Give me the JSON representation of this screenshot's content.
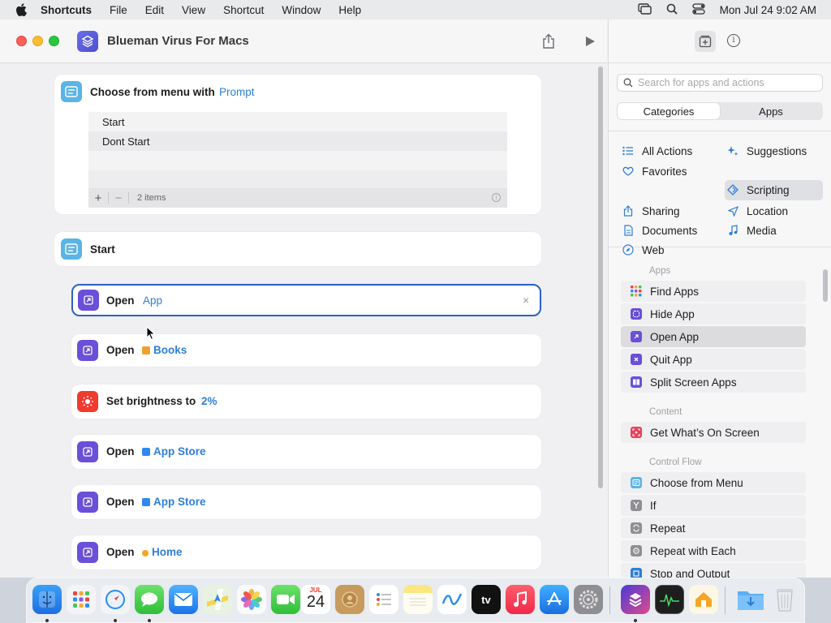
{
  "menubar": {
    "app_name": "Shortcuts",
    "menus": [
      "File",
      "Edit",
      "View",
      "Shortcut",
      "Window",
      "Help"
    ],
    "clock": "Mon Jul 24  9:02 AM"
  },
  "window": {
    "title": "Blueman Virus For Macs"
  },
  "editor": {
    "choose_menu": {
      "label": "Choose from menu with",
      "token": "Prompt",
      "items": [
        "Start",
        "Dont Start"
      ],
      "footer_count": "2 items"
    },
    "start_block": {
      "label": "Start"
    },
    "actions": [
      {
        "label": "Open",
        "token": "App",
        "token_bold": false,
        "icon": "open-app-icon",
        "color": "#6a4fd8"
      },
      {
        "label": "Open",
        "token": "Books",
        "token_bold": true,
        "icon": "open-app-icon",
        "color": "#6a4fd8",
        "mini_color": "#f0a030"
      },
      {
        "label": "Set brightness to",
        "token": "2%",
        "token_bold": true,
        "icon": "brightness-icon",
        "color": "#f03a2e"
      },
      {
        "label": "Open",
        "token": "App Store",
        "token_bold": true,
        "icon": "open-app-icon",
        "color": "#6a4fd8",
        "mini_color": "#2e8af0"
      },
      {
        "label": "Open",
        "token": "App Store",
        "token_bold": true,
        "icon": "open-app-icon",
        "color": "#6a4fd8",
        "mini_color": "#2e8af0"
      },
      {
        "label": "Open",
        "token": "Home",
        "token_bold": true,
        "icon": "open-app-icon",
        "color": "#6a4fd8",
        "mini_color": "#f5a623"
      }
    ]
  },
  "panel": {
    "search_placeholder": "Search for apps and actions",
    "segments": [
      "Categories",
      "Apps"
    ],
    "categories": [
      {
        "label": "All Actions",
        "icon": "list-icon"
      },
      {
        "label": "Suggestions",
        "icon": "sparkle-icon"
      },
      {
        "label": "Favorites",
        "icon": "heart-icon"
      },
      {
        "label": "Scripting",
        "icon": "scripting-icon"
      },
      {
        "label": "Sharing",
        "icon": "share-icon"
      },
      {
        "label": "Location",
        "icon": "location-icon"
      },
      {
        "label": "Documents",
        "icon": "document-icon"
      },
      {
        "label": "Media",
        "icon": "music-note-icon"
      },
      {
        "label": "Web",
        "icon": "compass-icon"
      }
    ],
    "sections": [
      {
        "title": "Apps",
        "items": [
          "Find Apps",
          "Hide App",
          "Open App",
          "Quit App",
          "Split Screen Apps"
        ]
      },
      {
        "title": "Content",
        "items": [
          "Get What’s On Screen"
        ]
      },
      {
        "title": "Control Flow",
        "items": [
          "Choose from Menu",
          "If",
          "Repeat",
          "Repeat with Each",
          "Stop and Output"
        ]
      }
    ]
  },
  "dock": {
    "calendar_month": "JUL",
    "calendar_day": "24",
    "tv_label": "tv"
  },
  "colors": {
    "accent_blue": "#2e7fd6",
    "open_app_purple": "#6a4fd8",
    "brightness_red": "#f03a2e",
    "menu_teal": "#5ab4e6"
  }
}
